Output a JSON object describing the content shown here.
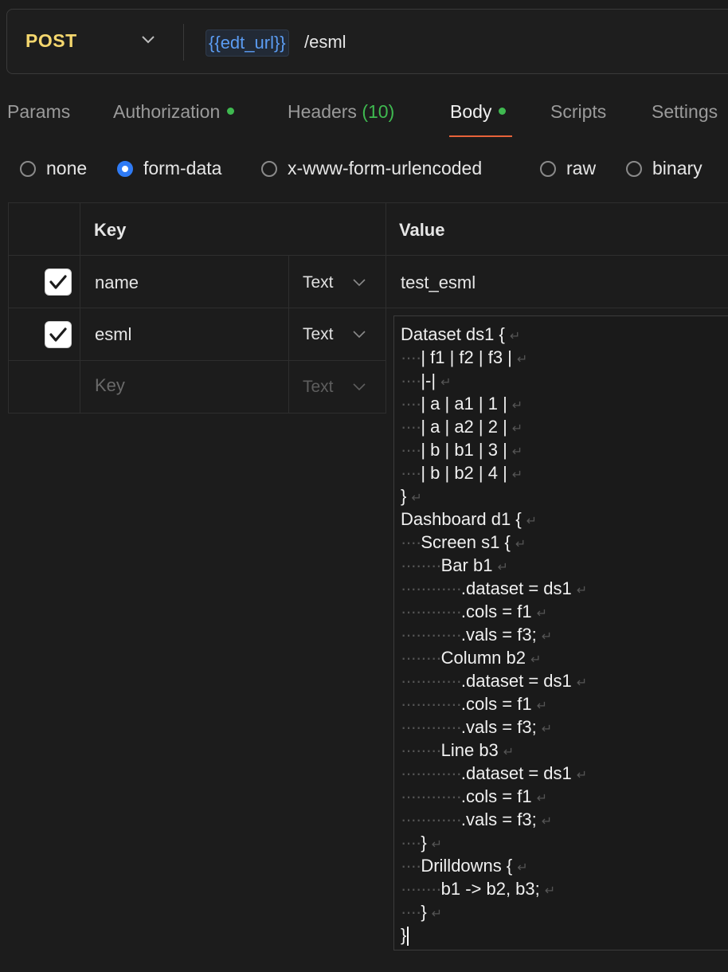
{
  "request": {
    "method": "POST",
    "url_variable": "{{edt_url}}",
    "url_path": "/esml"
  },
  "tabs": [
    {
      "label": "Params"
    },
    {
      "label": "Authorization"
    },
    {
      "label": "Headers",
      "count": "(10)"
    },
    {
      "label": "Body"
    },
    {
      "label": "Scripts"
    },
    {
      "label": "Settings"
    }
  ],
  "body_types": [
    "none",
    "form-data",
    "x-www-form-urlencoded",
    "raw",
    "binary"
  ],
  "selected_body_type": "form-data",
  "form_table": {
    "headers": {
      "key": "Key",
      "value": "Value"
    },
    "rows": [
      {
        "checked": true,
        "key": "name",
        "type": "Text",
        "value": "test_esml"
      },
      {
        "checked": true,
        "key": "esml",
        "type": "Text",
        "value": ""
      }
    ],
    "new_row": {
      "key_placeholder": "Key",
      "type": "Text"
    }
  },
  "esml_code": [
    "Dataset ds1 {",
    "  | f1 | f2 | f3 |",
    "  |-|",
    "  | a | a1 | 1 |",
    "  | a | a2 | 2 |",
    "  | b | b1 | 3 |",
    "  | b | b2 | 4 |",
    "}",
    "Dashboard d1 {",
    "  Screen s1 {",
    "    Bar b1",
    "      .dataset = ds1",
    "      .cols = f1",
    "      .vals = f3;",
    "    Column b2",
    "      .dataset = ds1",
    "      .cols = f1",
    "      .vals = f3;",
    "    Line b3",
    "      .dataset = ds1",
    "      .cols = f1",
    "      .vals = f3;",
    "  }",
    "  Drilldowns {",
    "    b1 -> b2, b3;",
    "  }",
    "}"
  ],
  "colors": {
    "method": "#f5d76e",
    "variable": "#5b9cf2",
    "active_dot": "#3fb950",
    "tab_underline": "#e8633a",
    "radio_selected": "#2f7bf5"
  },
  "icons": {
    "method_dropdown": "chevron-down-icon",
    "type_dropdown": "chevron-down-icon",
    "checkbox": "checkmark-icon",
    "whitespace": "middle-dot",
    "line_return": "return-arrow"
  }
}
